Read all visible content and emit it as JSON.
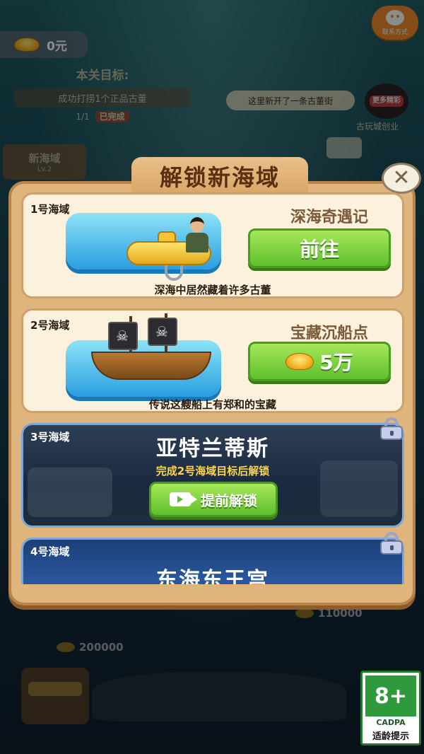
{
  "hud": {
    "money": "0元",
    "contact_label": "联系方式"
  },
  "background": {
    "goal_title": "本关目标:",
    "goal_desc": "成功打捞1个正品古董",
    "goal_progress": "1/1",
    "goal_status": "已完成",
    "area_sign": "新海域",
    "area_level": "Lv.2",
    "news": "这里新开了一条古董街",
    "more_label": "更多精彩",
    "more_caption": "古玩城创业",
    "num_a": "110000",
    "num_b": "200000"
  },
  "modal": {
    "title": "解锁新海域",
    "close_symbol": "✕",
    "areas": [
      {
        "tag": "1号海域",
        "title": "深海奇遇记",
        "button": "前往",
        "desc": "深海中居然藏着许多古董"
      },
      {
        "tag": "2号海域",
        "title": "宝藏沉船点",
        "button": "5万",
        "desc": "传说这艘船上有郑和的宝藏"
      },
      {
        "tag": "3号海域",
        "title": "亚特兰蒂斯",
        "sub": "完成2号海域目标后解锁",
        "button": "提前解锁",
        "icon": "video-icon"
      },
      {
        "tag": "4号海域",
        "title": "东海东王宫"
      }
    ]
  },
  "age_rating": {
    "grade": "8+",
    "org": "CADPA",
    "hint": "适龄提示"
  },
  "colors": {
    "panel": "#e0b57d",
    "card": "#fbf1dc",
    "button_green": "#5fbf2d",
    "title_brown": "#5a2f12",
    "locked_blue": "#1a2940"
  }
}
